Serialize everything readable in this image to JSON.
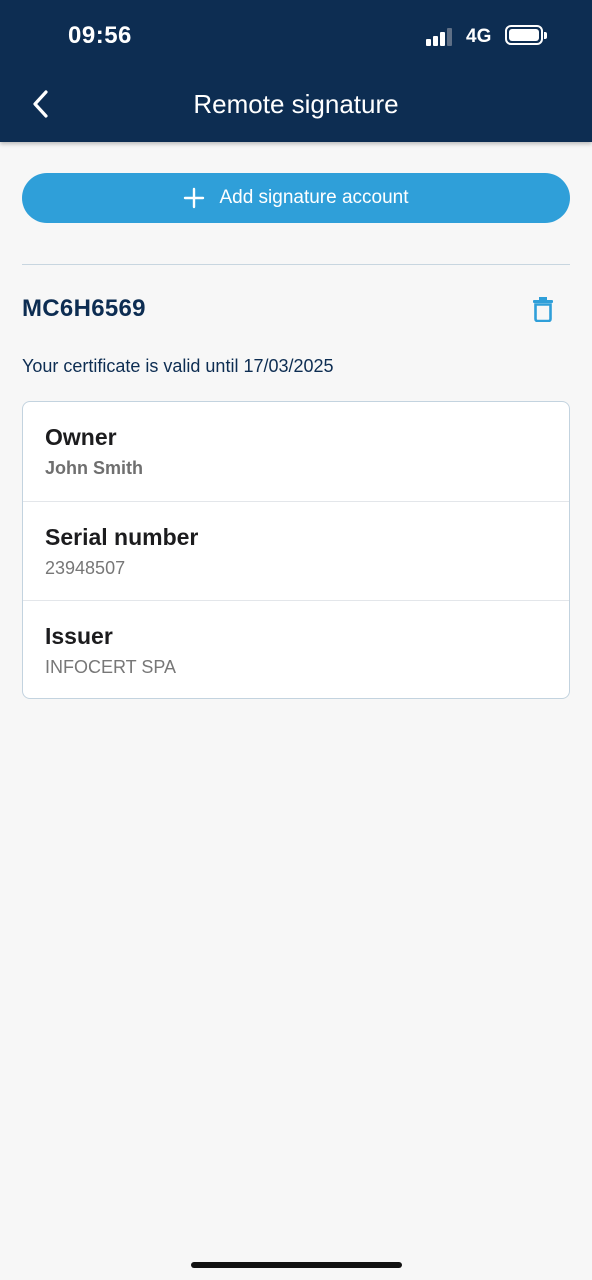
{
  "status_bar": {
    "time": "09:56",
    "network": "4G"
  },
  "header": {
    "title": "Remote signature",
    "back_icon": "chevron-left-icon"
  },
  "add_account": {
    "label": "Add signature account",
    "icon": "plus-icon"
  },
  "account": {
    "id": "MC6H6569",
    "validity": "Your certificate is valid until 17/03/2025",
    "delete_icon": "trash-icon",
    "details": [
      {
        "label": "Owner",
        "value": "John Smith"
      },
      {
        "label": "Serial number",
        "value": "23948507"
      },
      {
        "label": "Issuer",
        "value": "INFOCERT SPA"
      }
    ]
  },
  "colors": {
    "header_bg": "#0d2d52",
    "accent": "#2f9fd9",
    "background": "#f7f7f7"
  }
}
